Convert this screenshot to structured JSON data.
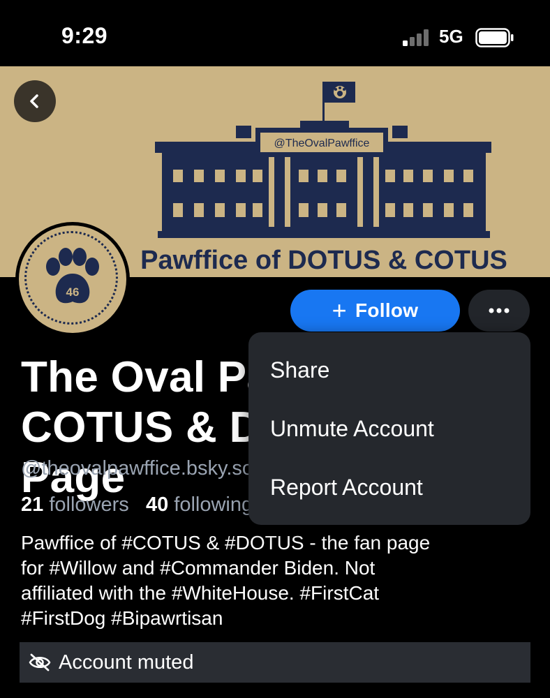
{
  "status_bar": {
    "time": "9:29",
    "network": "5G"
  },
  "banner": {
    "account_tag": "@TheOvalPawffice",
    "headline": "Pawffice of DOTUS & COTUS"
  },
  "avatar": {
    "badge_number": "46"
  },
  "actions": {
    "follow_label": "Follow",
    "more_icon": "ellipsis-icon"
  },
  "profile": {
    "display_name": "The Oval Pawffice: COTUS & DOTUS Fan Page",
    "handle": "@theovalpawffice.bsky.social",
    "followers_count": "21",
    "followers_label": "followers",
    "following_count": "40",
    "following_label": "following",
    "bio": "Pawffice of #COTUS & #DOTUS - the fan page\nfor #Willow and #Commander Biden. Not\naffiliated with the #WhiteHouse. #FirstCat\n#FirstDog #Bipawrtisan",
    "muted_label": "Account muted"
  },
  "menu": {
    "items": [
      {
        "label": "Share"
      },
      {
        "label": "Unmute Account"
      },
      {
        "label": "Report Account"
      }
    ]
  },
  "colors": {
    "background": "#000000",
    "banner_gold": "#cbb484",
    "navy": "#1d2a4f",
    "accent_blue": "#1877f2",
    "menu_bg": "#25282d",
    "muted_text": "#9aa4b2"
  }
}
